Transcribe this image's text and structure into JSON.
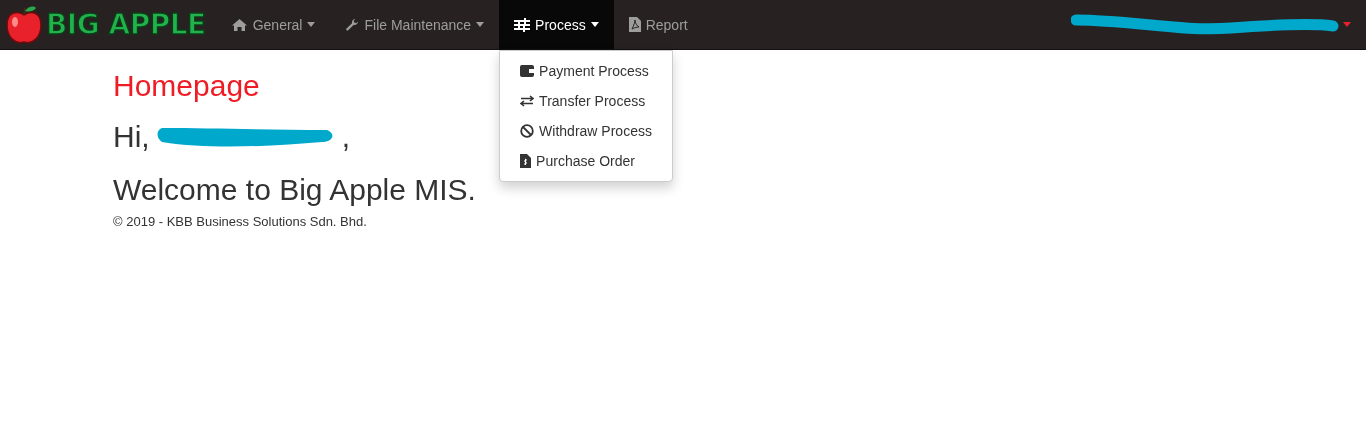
{
  "logo": {
    "text": "BIG APPLE"
  },
  "nav": [
    {
      "label": "General",
      "selected": false,
      "dropdown": true
    },
    {
      "label": "File Maintenance",
      "selected": false,
      "dropdown": true
    },
    {
      "label": "Process",
      "selected": true,
      "dropdown": true
    },
    {
      "label": "Report",
      "selected": false,
      "dropdown": false
    }
  ],
  "process_menu": [
    "Payment Process",
    "Transfer Process",
    "Withdraw Process",
    "Purchase Order"
  ],
  "page": {
    "title": "Homepage",
    "greeting": "Hi,",
    "greeting_end": ",",
    "welcome": "Welcome to Big Apple MIS.",
    "footer": "© 2019 - KBB Business Solutions Sdn. Bhd."
  }
}
